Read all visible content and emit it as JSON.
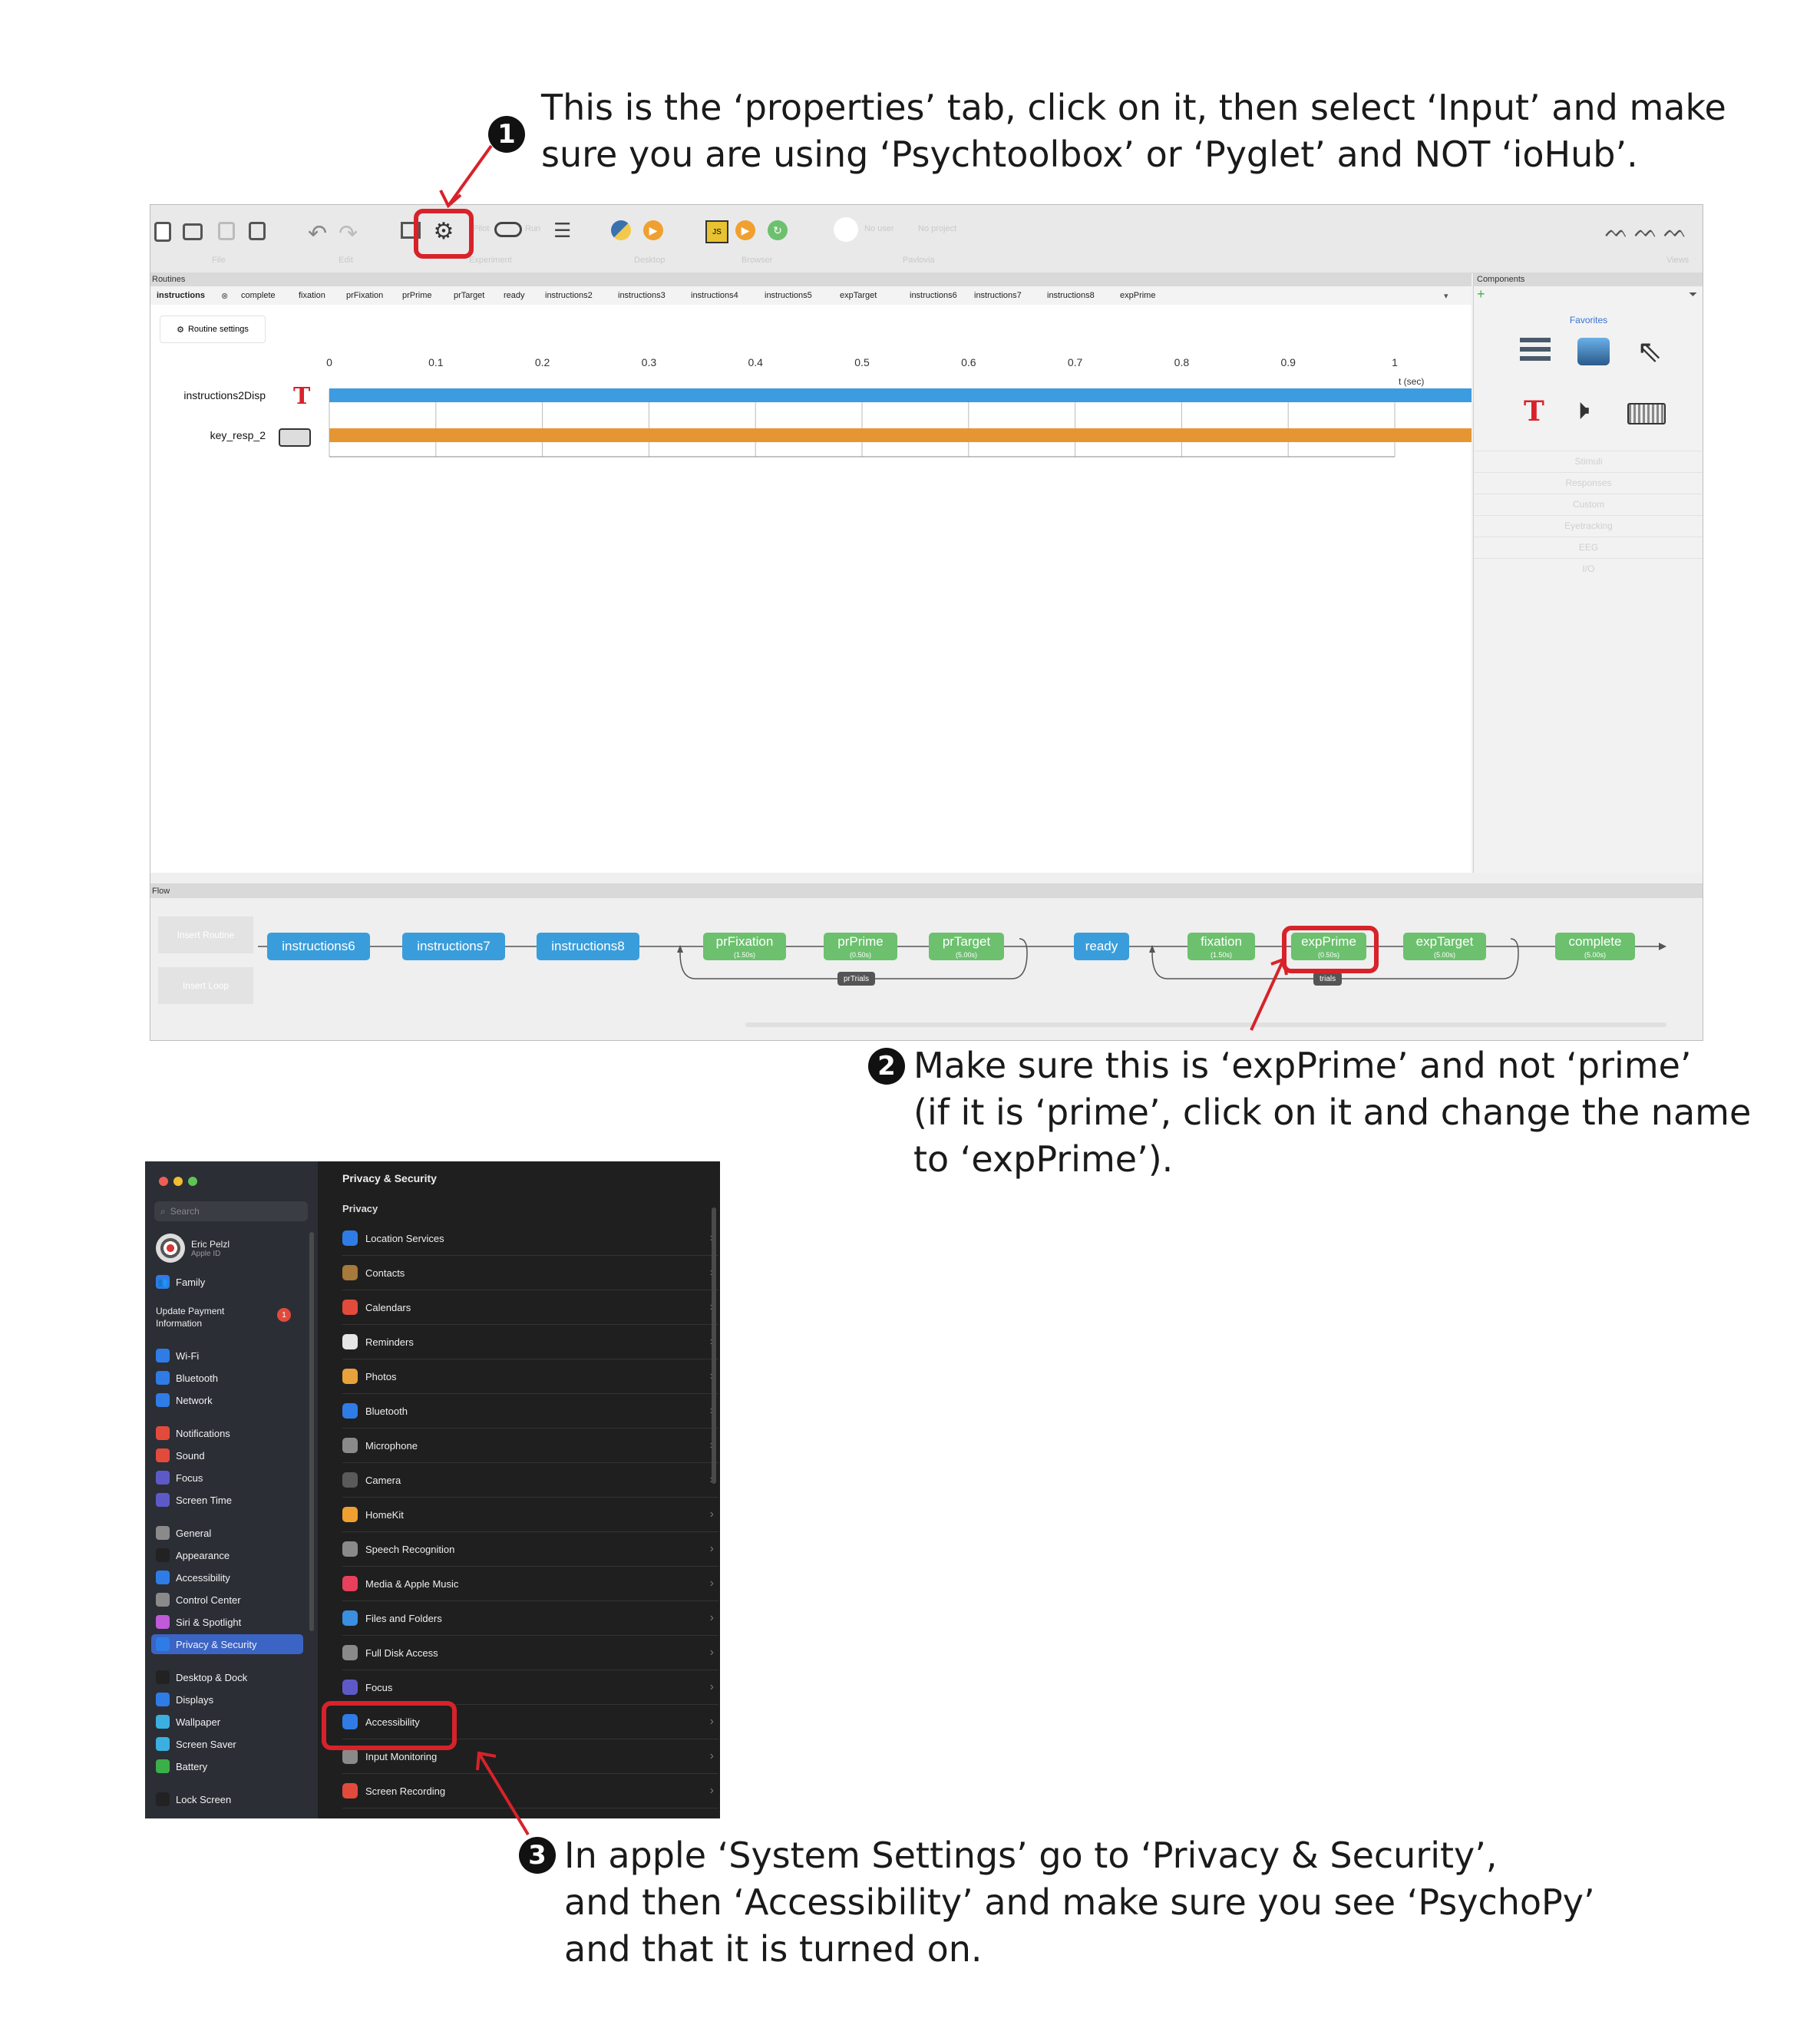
{
  "callouts": {
    "c1": {
      "num": "1",
      "lines": [
        "This is the ‘properties’ tab, click on it, then select ‘Input’ and make",
        "sure you are using ‘Psychtoolbox’ or ‘Pyglet’ and NOT ‘ioHub’."
      ]
    },
    "c2": {
      "num": "2",
      "lines": [
        "Make sure this is ‘expPrime’ and not ‘prime’",
        "(if it is ‘prime’, click on it and change the name",
        "to ‘expPrime’)."
      ]
    },
    "c3": {
      "num": "3",
      "lines": [
        "In apple ‘System Settings’ go to ‘Privacy & Security’,",
        "and then ‘Accessibility’ and make sure you see ‘PsychoPy’",
        "and that it is turned on."
      ]
    }
  },
  "builder": {
    "toolbar": {
      "file": "File",
      "edit": "Edit",
      "experiment": "Experiment",
      "desktop": "Desktop",
      "browser": "Browser",
      "pavlovia": "Pavlovia",
      "views": "Views",
      "pilot": "Pilot",
      "run": "Run",
      "user": "No user",
      "project": "No project"
    },
    "routines_label": "Routines",
    "components_label": "Components",
    "routine_tabs": [
      "instructions",
      "complete",
      "fixation",
      "prFixation",
      "prPrime",
      "prTarget",
      "ready",
      "instructions2",
      "instructions3",
      "instructions4",
      "instructions5",
      "expTarget",
      "instructions6",
      "instructions7",
      "instructions8",
      "expPrime"
    ],
    "routine_settings": "Routine settings",
    "ticks": [
      "0",
      "0.1",
      "0.2",
      "0.3",
      "0.4",
      "0.5",
      "0.6",
      "0.7",
      "0.8",
      "0.9",
      "1"
    ],
    "time_unit": "t (sec)",
    "timeline": [
      {
        "name": "instructions2Disp",
        "color": "#3d9be0"
      },
      {
        "name": "key_resp_2",
        "color": "#e59633"
      }
    ],
    "favorites": "Favorites",
    "categories": [
      "Stimuli",
      "Responses",
      "Custom",
      "Eyetracking",
      "EEG",
      "I/O"
    ],
    "flow_label": "Flow",
    "insert_routine": "Insert Routine",
    "insert_loop": "Insert Loop",
    "flow": [
      {
        "label": "instructions6",
        "type": "blue"
      },
      {
        "label": "instructions7",
        "type": "blue"
      },
      {
        "label": "instructions8",
        "type": "blue"
      },
      {
        "label": "prFixation",
        "sub": "(1.50s)",
        "type": "green"
      },
      {
        "label": "prPrime",
        "sub": "(0.50s)",
        "type": "green"
      },
      {
        "label": "prTarget",
        "sub": "(5.00s)",
        "type": "green"
      },
      {
        "label": "ready",
        "type": "blue"
      },
      {
        "label": "fixation",
        "sub": "(1.50s)",
        "type": "green"
      },
      {
        "label": "expPrime",
        "sub": "(0.50s)",
        "type": "green"
      },
      {
        "label": "expTarget",
        "sub": "(5.00s)",
        "type": "green"
      },
      {
        "label": "complete",
        "sub": "(5.00s)",
        "type": "green"
      }
    ],
    "loops": [
      "prTrials",
      "trials"
    ]
  },
  "mac": {
    "search": "Search",
    "user_name": "Eric Pelzl",
    "user_sub": "Apple ID",
    "family": "Family",
    "update": [
      "Update Payment",
      "Information"
    ],
    "update_badge": "1",
    "sidebar": [
      "Wi-Fi",
      "Bluetooth",
      "Network",
      "Notifications",
      "Sound",
      "Focus",
      "Screen Time",
      "General",
      "Appearance",
      "Accessibility",
      "Control Center",
      "Siri & Spotlight",
      "Privacy & Security",
      "Desktop & Dock",
      "Displays",
      "Wallpaper",
      "Screen Saver",
      "Battery",
      "Lock Screen"
    ],
    "title": "Privacy & Security",
    "section": "Privacy",
    "items": [
      "Location Services",
      "Contacts",
      "Calendars",
      "Reminders",
      "Photos",
      "Bluetooth",
      "Microphone",
      "Camera",
      "HomeKit",
      "Speech Recognition",
      "Media & Apple Music",
      "Files and Folders",
      "Full Disk Access",
      "Focus",
      "Accessibility",
      "Input Monitoring",
      "Screen Recording"
    ],
    "item_colors": [
      "#2f7ce6",
      "#a57a3a",
      "#e24b3c",
      "#e6e6e6",
      "#e8a23b",
      "#2f7ce6",
      "#8a8a8a",
      "#5a5a5a",
      "#f0a030",
      "#8a8a8a",
      "#e8405a",
      "#3b8ee0",
      "#8a8a8a",
      "#5d5ac8",
      "#2f7ce6",
      "#8a8a8a",
      "#e24b3c"
    ],
    "sidebar_colors": [
      "#2f7ce6",
      "#2f7ce6",
      "#2f7ce6",
      "#e24b3c",
      "#e24b3c",
      "#5d5ac8",
      "#5d5ac8",
      "#8a8a8a",
      "#222",
      "#2f7ce6",
      "#8a8a8a",
      "#c05ad8",
      "#2f7ce6",
      "#222",
      "#2f7ce6",
      "#3bb0e0",
      "#3bb0e0",
      "#3bb04a",
      "#222"
    ]
  },
  "colors": {
    "highlight": "#d8222a"
  }
}
